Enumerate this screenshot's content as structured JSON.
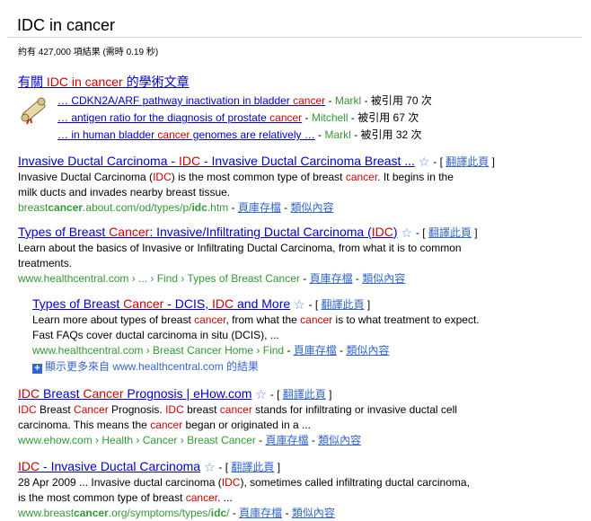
{
  "search": {
    "query": "IDC in cancer"
  },
  "stats": "約有 427,000 項結果 (需時 0.19 秒)",
  "scholar": {
    "title_prefix": "有關 ",
    "title_query": "IDC in cancer",
    "title_suffix": " 的學術文章",
    "items": [
      {
        "link_a": "… CDKN2A/ARF pathway inactivation in bladder ",
        "link_hl": "cancer",
        "link_b": "",
        "author": "Markl",
        "cited": "被引用 70 次"
      },
      {
        "link_a": "… antigen ratio for the diagnosis of prostate ",
        "link_hl": "cancer",
        "link_b": "",
        "author": "Mitchell",
        "cited": "被引用 67 次"
      },
      {
        "link_a": "… in human bladder ",
        "link_hl": "cancer",
        "link_b": " genomes are relatively …",
        "author": "Markl",
        "cited": "被引用 32 次"
      }
    ]
  },
  "labels": {
    "translate": "翻譯此頁",
    "cache": "頁庫存檔",
    "similar": "類似內容",
    "sep": " - "
  },
  "results": [
    {
      "title_a": "Invasive Ductal Carcinoma - ",
      "title_hl": "IDC",
      "title_b": " - Invasive Ductal Carcinoma Breast ...",
      "snip1_a": "Invasive Ductal Carcinoma (",
      "snip1_hl": "IDC",
      "snip1_b": ") is the most common type of breast ",
      "snip1_hl2": "cancer",
      "snip1_c": ". It begins in the",
      "snip2": "milk ducts and invades nearby breast tissue.",
      "url_a": "breast",
      "url_b": "cancer",
      "url_c": ".about.com/od/types/p/",
      "url_d": "idc",
      "url_e": ".htm"
    },
    {
      "title_a": "Types of Breast ",
      "title_hl": "Cancer",
      "title_b": ": Invasive/Infiltrating Ductal Carcinoma (",
      "title_hl2": "IDC",
      "title_c": ")",
      "snip1": "Learn about the basics of Invasive or Infiltrating Ductal Carcinoma, from what it is to common",
      "snip2": "treatments.",
      "url": "www.healthcentral.com › ... › Find › Types of Breast Cancer"
    },
    {
      "title_a": "Types of Breast ",
      "title_hl": "Cancer",
      "title_b": " - DCIS, ",
      "title_hl2": "IDC",
      "title_c": " and More",
      "snip1_a": "Learn more about types of breast ",
      "snip1_hl": "cancer",
      "snip1_b": ", from what the ",
      "snip1_hl2": "cancer",
      "snip1_c": " is to what treatment to expect.",
      "snip2": "Fast FAQs cover ductal carcinoma in situ (DCIS), ...",
      "url": "www.healthcentral.com › Breast Cancer Home › Find",
      "more": "顯示更多來自 www.healthcentral.com 的結果"
    },
    {
      "title_hl": "IDC",
      "title_a": " Breast ",
      "title_hl2": "Cancer",
      "title_b": " Prognosis | eHow.com",
      "snip1_hl": "IDC",
      "snip1_a": " Breast ",
      "snip1_hl2": "Cancer",
      "snip1_b": " Prognosis. ",
      "snip1_hl3": "IDC",
      "snip1_c": " breast ",
      "snip1_hl4": "cancer",
      "snip1_d": " stands for infiltrating or invasive ductal cell",
      "snip2_a": "carcinoma. This means the ",
      "snip2_hl": "cancer",
      "snip2_b": " began or originated in a ...",
      "url": "www.ehow.com › Health › Cancer › Breast Cancer"
    },
    {
      "title_hl": "IDC",
      "title_a": " - Invasive Ductal Carcinoma",
      "snip1_a": "28 Apr 2009 ... Invasive ductal carcinoma (",
      "snip1_hl": "IDC",
      "snip1_b": "), sometimes called infiltrating ductal carcinoma,",
      "snip2_a": "is the most common type of breast ",
      "snip2_hl": "cancer",
      "snip2_b": ". ...",
      "url_a": "www.breast",
      "url_b": "cancer",
      "url_c": ".org/symptoms/types/",
      "url_d": "idc",
      "url_e": "/"
    }
  ]
}
